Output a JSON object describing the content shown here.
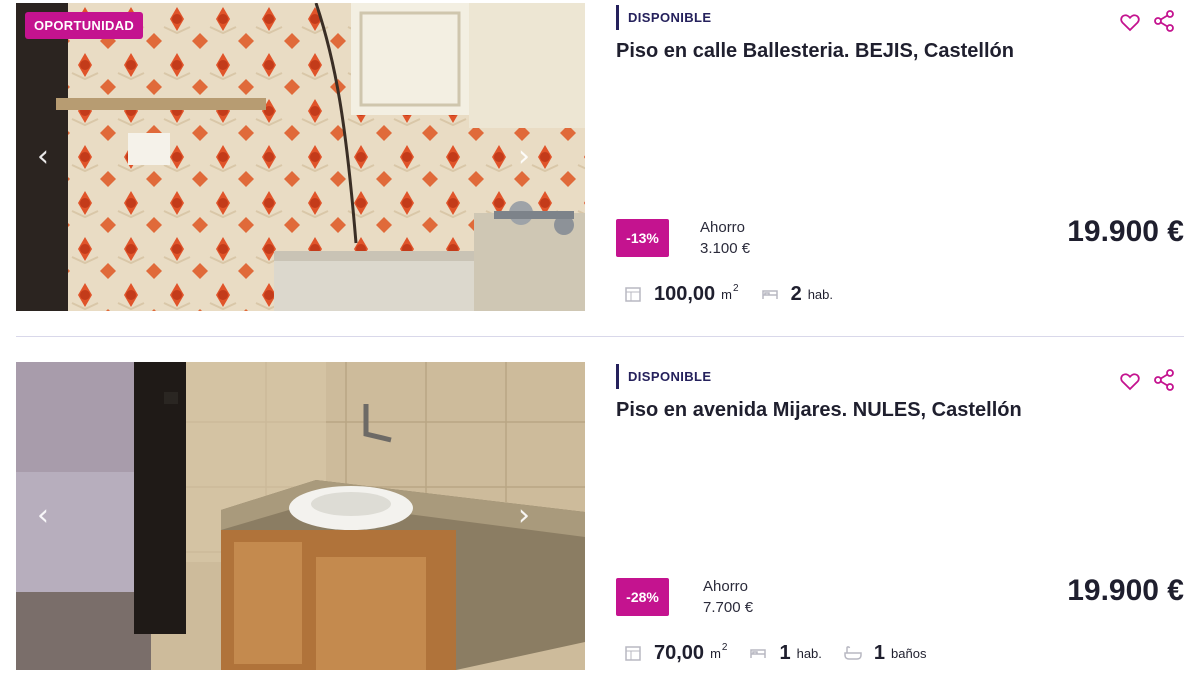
{
  "listings": [
    {
      "badge": "OPORTUNIDAD",
      "status": "DISPONIBLE",
      "title": "Piso en calle Ballesteria. BEJIS, Castellón",
      "discount": "-13%",
      "saving_label": "Ahorro",
      "saving_value": "3.100 €",
      "price": "19.900 €",
      "area": "100,00",
      "area_unit": "m",
      "area_sup": "2",
      "rooms": "2",
      "rooms_unit": "hab.",
      "photo": "kitchen-orange-tiles-photo"
    },
    {
      "status": "DISPONIBLE",
      "title": "Piso en avenida Mijares. NULES, Castellón",
      "discount": "-28%",
      "saving_label": "Ahorro",
      "saving_value": "7.700 €",
      "price": "19.900 €",
      "area": "70,00",
      "area_unit": "m",
      "area_sup": "2",
      "rooms": "1",
      "rooms_unit": "hab.",
      "baths": "1",
      "baths_unit": "baños",
      "photo": "kitchen-granite-counter-photo"
    }
  ],
  "icons": {
    "favorite": "heart-icon",
    "share": "share-icon",
    "area": "floorplan-icon",
    "rooms": "bed-icon",
    "baths": "bathtub-icon",
    "prev": "chevron-left-icon",
    "next": "chevron-right-icon"
  },
  "colors": {
    "accent": "#c4138f",
    "navy": "#25215c",
    "text": "#1f1f2e"
  }
}
